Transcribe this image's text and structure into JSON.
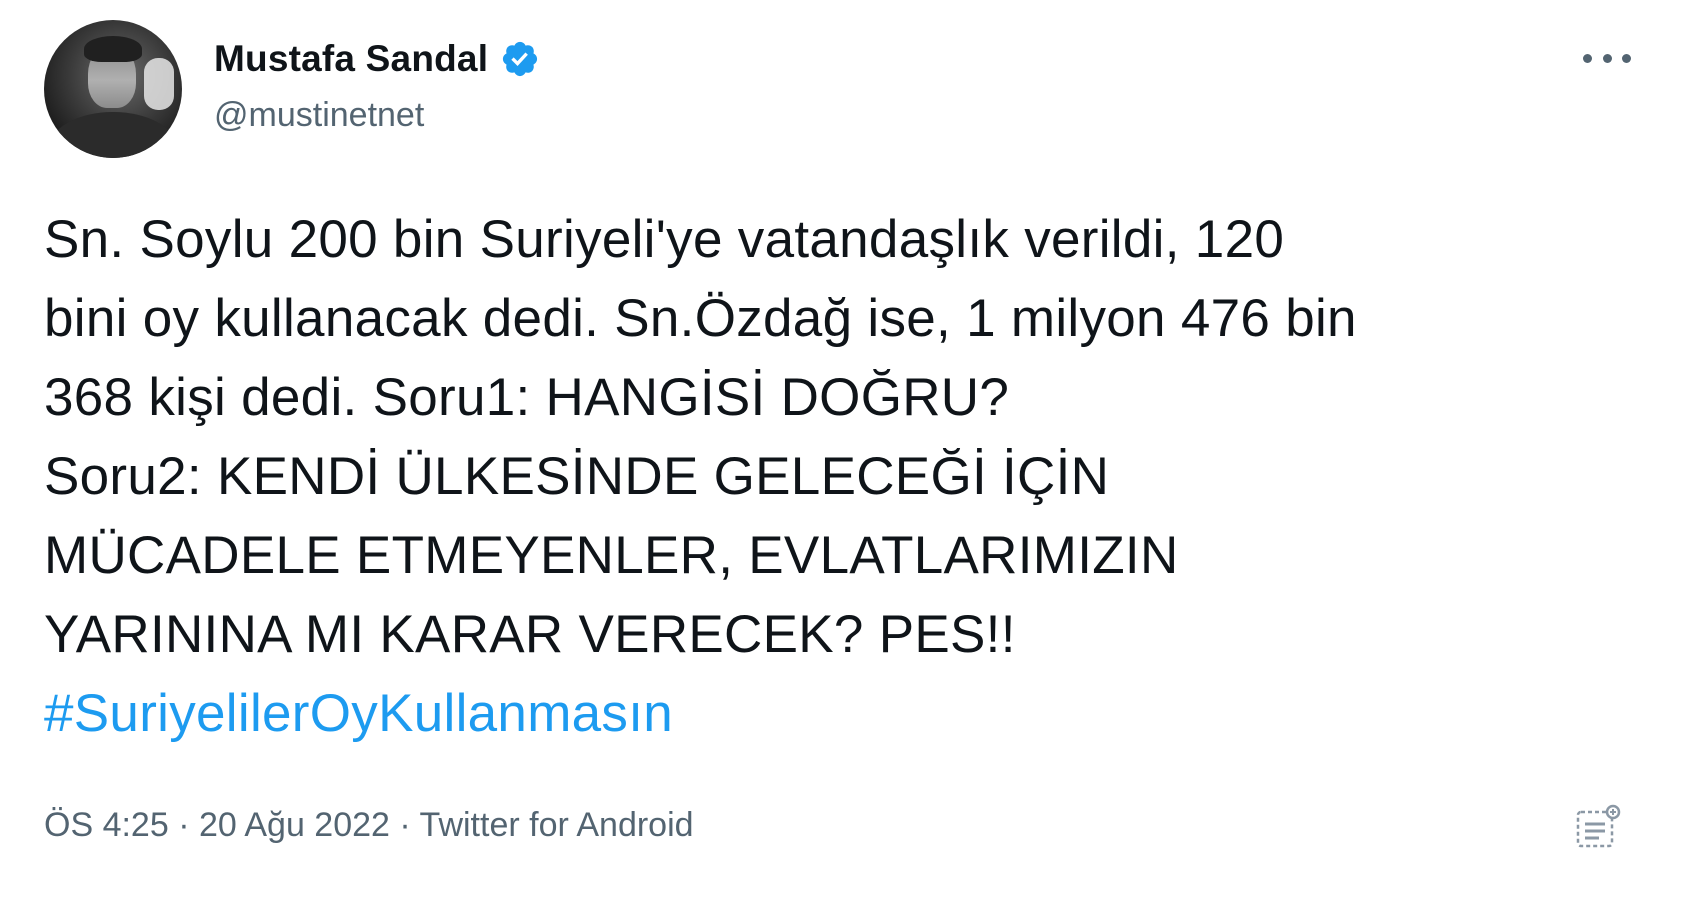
{
  "author": {
    "display_name": "Mustafa Sandal",
    "handle": "@mustinetnet",
    "verified": true
  },
  "tweet": {
    "lines": [
      "Sn. Soylu 200 bin Suriyeli'ye vatandaşlık verildi, 120",
      "bini oy kullanacak dedi. Sn.Özdağ ise, 1 milyon 476 bin",
      "368 kişi dedi. Soru1: HANGİSİ DOĞRU?",
      "Soru2: KENDİ ÜLKESİNDE GELECEĞİ İÇİN",
      "MÜCADELE ETMEYENLER, EVLATLARIMIZIN",
      "YARININA MI KARAR VERECEK? PES!!"
    ],
    "hashtag": "#SuriyelilerOyKullanmasın"
  },
  "meta": {
    "time": "ÖS 4:25",
    "separator1": " · ",
    "date": "20 Ağu 2022",
    "separator2": " · ",
    "source": "Twitter for Android"
  },
  "icons": {
    "verified": "verified-badge-icon",
    "more": "more-options-icon",
    "analytics": "analytics-icon"
  },
  "colors": {
    "text": "#0f1419",
    "secondary": "#536471",
    "accent": "#1d9bf0"
  }
}
